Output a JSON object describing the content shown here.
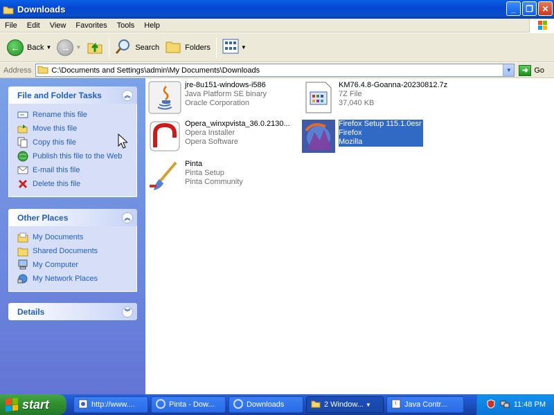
{
  "window": {
    "title": "Downloads"
  },
  "menu": [
    "File",
    "Edit",
    "View",
    "Favorites",
    "Tools",
    "Help"
  ],
  "toolbar": {
    "back": "Back",
    "search": "Search",
    "folders": "Folders"
  },
  "address": {
    "label": "Address",
    "path": "C:\\Documents and Settings\\admin\\My Documents\\Downloads",
    "go": "Go"
  },
  "tasks": {
    "file_folder": {
      "title": "File and Folder Tasks",
      "items": [
        "Rename this file",
        "Move this file",
        "Copy this file",
        "Publish this file to the Web",
        "E-mail this file",
        "Delete this file"
      ]
    },
    "other_places": {
      "title": "Other Places",
      "items": [
        "My Documents",
        "Shared Documents",
        "My Computer",
        "My Network Places"
      ]
    },
    "details": {
      "title": "Details"
    }
  },
  "files": [
    {
      "name": "jre-8u151-windows-i586",
      "type": "Java Platform SE binary",
      "company": "Oracle Corporation",
      "icon": "java-icon"
    },
    {
      "name": "KM76.4.8-Goanna-20230812.7z",
      "type": "7Z File",
      "company": "37,040 KB",
      "icon": "archive-icon"
    },
    {
      "name": "Opera_winxpvista_36.0.2130...",
      "type": "Opera Installer",
      "company": "Opera Software",
      "icon": "opera-icon"
    },
    {
      "name": "Firefox Setup 115.1.0esr",
      "type": "Firefox",
      "company": "Mozilla",
      "icon": "firefox-icon",
      "selected": true
    },
    {
      "name": "Pinta",
      "type": "Pinta Setup",
      "company": "Pinta Community",
      "icon": "pinta-icon"
    }
  ],
  "taskbar": {
    "start": "start",
    "buttons": [
      "http://www....",
      "Pinta - Dow...",
      "Downloads",
      "2 Window...",
      "Java Contr..."
    ],
    "clock": "11:48 PM"
  }
}
